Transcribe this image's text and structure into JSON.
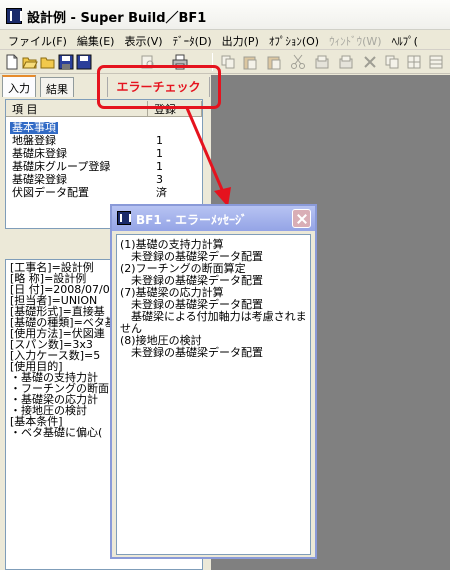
{
  "window": {
    "title": "設計例 - Super Build／BF1"
  },
  "menu": {
    "items": [
      {
        "label": "ファイル(F)",
        "disabled": false
      },
      {
        "label": "編集(E)",
        "disabled": false
      },
      {
        "label": "表示(V)",
        "disabled": false
      },
      {
        "label": "ﾃﾞｰﾀ(D)",
        "disabled": false
      },
      {
        "label": "出力(P)",
        "disabled": false
      },
      {
        "label": "ｵﾌﾟｼｮﾝ(O)",
        "disabled": false
      },
      {
        "label": "ｳｨﾝﾄﾞｳ(W)",
        "disabled": true
      },
      {
        "label": "ﾍﾙﾌﾟ(",
        "disabled": false
      }
    ]
  },
  "toolbar": {
    "error_check_label": "エラーチェック"
  },
  "tabs": [
    {
      "label": "入力"
    },
    {
      "label": "結果"
    }
  ],
  "list": {
    "headers": [
      "項 目",
      "登録"
    ],
    "rows": [
      {
        "item": "基本事項",
        "count": ""
      },
      {
        "item": "地盤登録",
        "count": "1"
      },
      {
        "item": "基礎床登録",
        "count": "1"
      },
      {
        "item": "基礎床グループ登録",
        "count": "1"
      },
      {
        "item": "基礎梁登録",
        "count": "3"
      },
      {
        "item": "伏図データ配置",
        "count": "済"
      }
    ]
  },
  "info": {
    "lines": [
      "[工事名]=設計例",
      "[略 称]=設計例",
      "[日 付]=2008/07/0",
      "[担当者]=UNION",
      "[基礎形式]=直接基",
      "[基礎の種類]=ベタ基",
      "[使用方法]=伏図連",
      "[スパン数]=3x3",
      "[入力ケース数]=5",
      "[使用目的]",
      "・基礎の支持力計",
      "・フーチングの断面",
      "・基礎梁の応力計",
      "・接地圧の検討",
      "[基本条件]",
      "・ベタ基礎に偏心("
    ]
  },
  "dialog": {
    "title": "BF1 - エラーﾒｯｾｰｼﾞ",
    "lines": [
      "(1)基礎の支持力計算",
      "　未登録の基礎梁データ配置",
      "(2)フーチングの断面算定",
      "　未登録の基礎梁データ配置",
      "(7)基礎梁の応力計算",
      "　未登録の基礎梁データ配置",
      "　基礎梁による付加軸力は考慮されま",
      "せん",
      "(8)接地圧の検討",
      "　未登録の基礎梁データ配置"
    ]
  },
  "colors": {
    "callout": "#e5131e",
    "selection": "#316ac5",
    "workspace": "#808080"
  }
}
